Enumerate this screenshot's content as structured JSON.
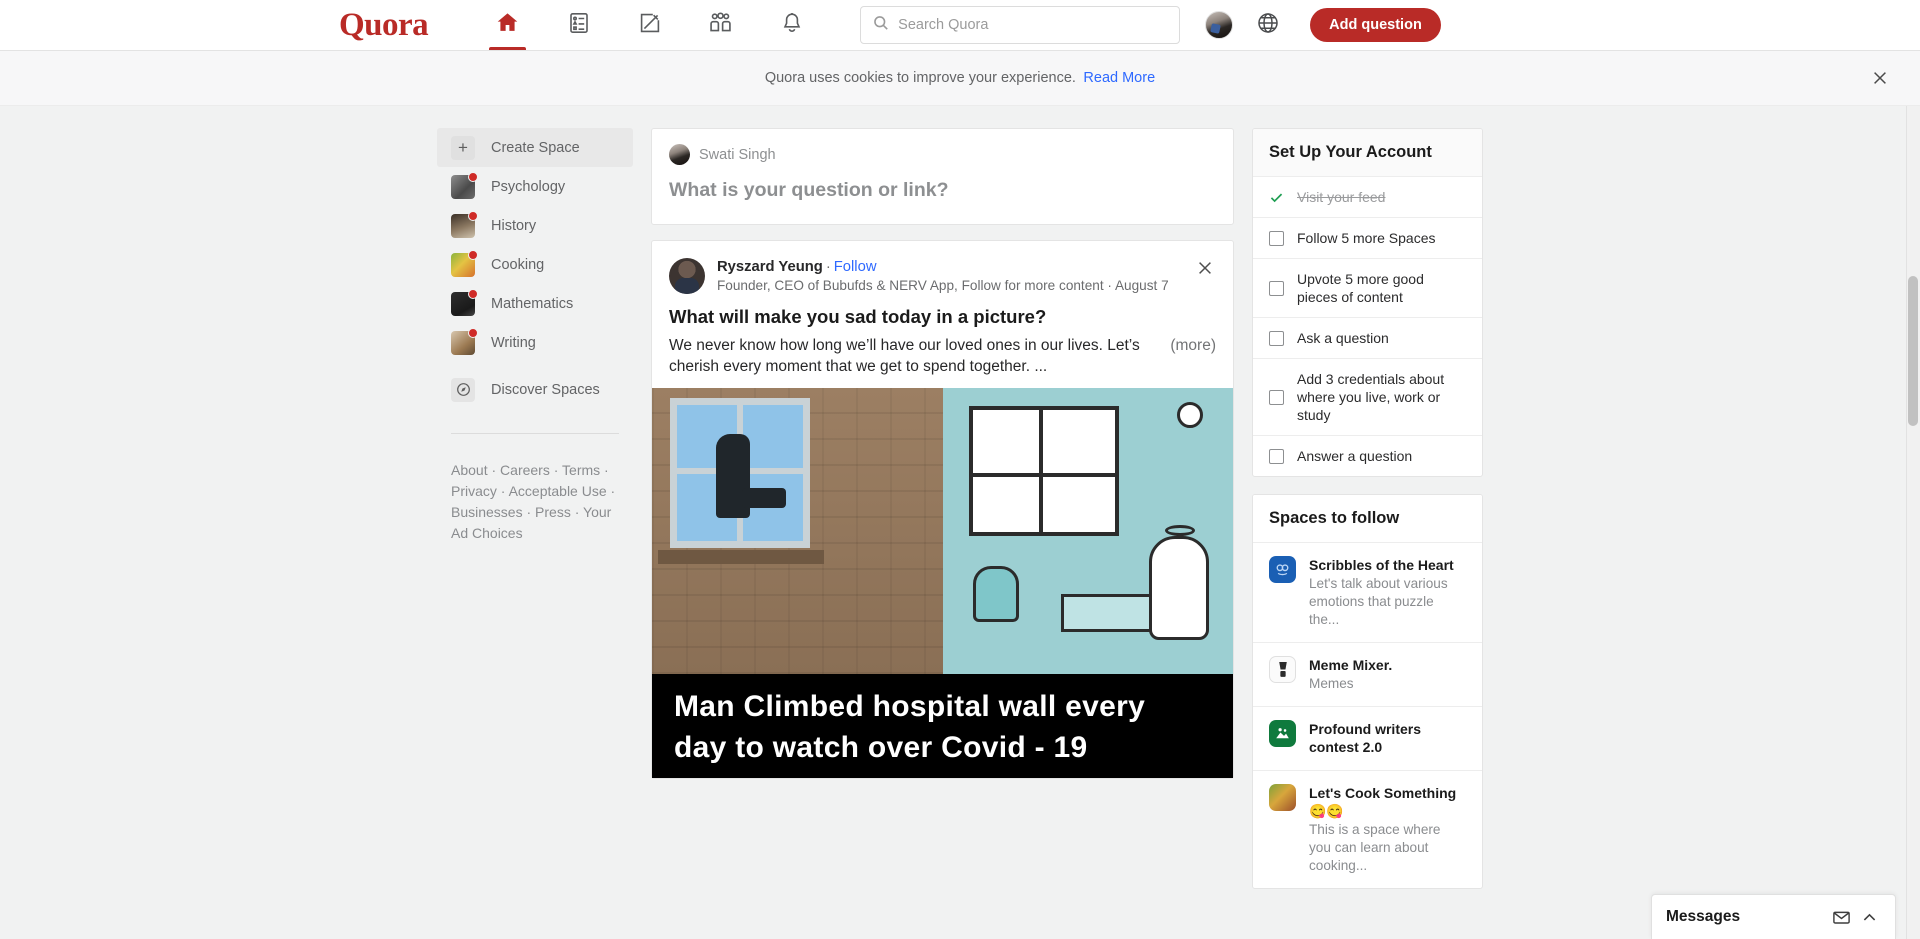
{
  "nav": {
    "logo": "Quora",
    "icons": [
      {
        "name": "home-icon",
        "label": "Home",
        "active": true
      },
      {
        "name": "answer-icon",
        "label": "Answer",
        "active": false
      },
      {
        "name": "write-icon",
        "label": "Write",
        "active": false
      },
      {
        "name": "spaces-icon",
        "label": "Spaces",
        "active": false
      },
      {
        "name": "notifications-icon",
        "label": "Notifications",
        "active": false
      }
    ],
    "search": {
      "placeholder": "Search Quora",
      "value": ""
    },
    "language_icon": "globe-icon",
    "avatar_label": "Swati Singh",
    "add_question_label": "Add question",
    "accent_color": "#b92b27"
  },
  "cookie_banner": {
    "text": "Quora uses cookies to improve your experience.",
    "link_label": "Read More",
    "link_color": "#2e69ff",
    "close_icon": "close-icon"
  },
  "sidebar": {
    "create_space_label": "Create Space",
    "items": [
      {
        "label": "Psychology",
        "has_badge": true
      },
      {
        "label": "History",
        "has_badge": true
      },
      {
        "label": "Cooking",
        "has_badge": true
      },
      {
        "label": "Mathematics",
        "has_badge": true
      },
      {
        "label": "Writing",
        "has_badge": true
      }
    ],
    "discover_label": "Discover Spaces",
    "footer": [
      "About",
      "Careers",
      "Terms",
      "Privacy",
      "Acceptable Use",
      "Businesses",
      "Press",
      "Your Ad Choices"
    ]
  },
  "composer": {
    "user": "Swati Singh",
    "prompt": "What is your question or link?"
  },
  "post": {
    "author": "Ryszard Yeung",
    "follow_label": "Follow",
    "credential": "Founder, CEO of Bubufds & NERV App, Follow for more content",
    "date": "August 7",
    "title": "What will make you sad today in a picture?",
    "body": "We never know how long we’ll have our loved ones in our lives. Let’s cherish every moment that we get to spend together. ...",
    "more_label": "(more)",
    "close_icon": "close-icon",
    "image_caption_line1": "Man Climbed hospital wall every",
    "image_caption_line2": "day to watch over Covid - 19"
  },
  "setup_panel": {
    "title": "Set Up Your Account",
    "tasks": [
      {
        "label": "Visit your feed",
        "done": true
      },
      {
        "label": "Follow 5 more Spaces",
        "done": false
      },
      {
        "label": "Upvote 5 more good pieces of content",
        "done": false
      },
      {
        "label": "Ask a question",
        "done": false
      },
      {
        "label": "Add 3 credentials about where you live, work or study",
        "done": false
      },
      {
        "label": "Answer a question",
        "done": false
      }
    ],
    "check_color": "#1e9e52"
  },
  "spaces_panel": {
    "title": "Spaces to follow",
    "items": [
      {
        "name": "Scribbles of the Heart",
        "desc": "Let's talk about various emotions that puzzle the...",
        "icon_color": "#1a5fb4"
      },
      {
        "name": "Meme Mixer.",
        "desc": "Memes",
        "icon_color": "#ffffff"
      },
      {
        "name": "Profound writers contest 2.0",
        "desc": "",
        "icon_color": "#0f7a3d"
      },
      {
        "name": "Let's Cook Something😋😋",
        "desc": "This is a space where you can learn about cooking...",
        "icon_color": "#7b5b33"
      }
    ]
  },
  "messages_dock": {
    "title": "Messages",
    "compose_icon": "envelope-icon",
    "expand_icon": "chevron-up-icon"
  }
}
